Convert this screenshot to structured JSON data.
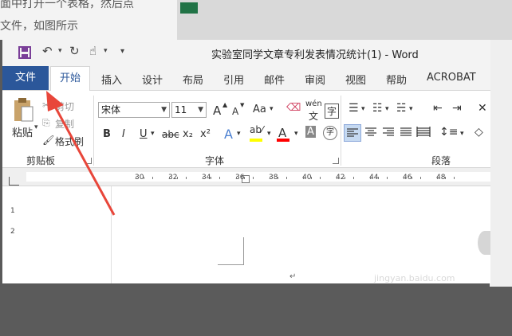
{
  "background": {
    "tutorial_text_line1": "面中打开一个表格，然后点",
    "tutorial_text_line2": "文件，如图所示"
  },
  "window": {
    "title": "实验室同学文章专利发表情况统计(1)  -  Word"
  },
  "quick_access": {
    "save_icon": "save-icon",
    "undo_icon": "undo-icon",
    "redo_icon": "redo-icon",
    "touch_icon": "touch-mode-icon",
    "customize_icon": "customize-icon"
  },
  "tabs": {
    "file": "文件",
    "home": "开始",
    "items": [
      "插入",
      "设计",
      "布局",
      "引用",
      "邮件",
      "审阅",
      "视图",
      "帮助",
      "ACROBAT"
    ]
  },
  "clipboard": {
    "paste_label": "粘贴",
    "cut_label": "剪切",
    "copy_label": "复制",
    "format_painter_label": "格式刷",
    "group_label": "剪贴板"
  },
  "font": {
    "font_name": "宋体",
    "font_size": "11",
    "grow_label": "A",
    "shrink_label": "A",
    "case_label": "Aa",
    "pinyin_label": "wén",
    "bold_label": "B",
    "italic_label": "I",
    "underline_label": "U",
    "strike_label": "abc",
    "sub_label": "x₂",
    "sup_label": "x²",
    "group_label": "字体",
    "char_border_label": "字",
    "highlight_color": "#ffff00",
    "font_color": "#ff0000"
  },
  "paragraph": {
    "group_label": "段落"
  },
  "ruler": {
    "numbers": [
      "30",
      "32",
      "34",
      "36",
      "38",
      "40",
      "42",
      "44",
      "46",
      "48"
    ]
  },
  "vertical_ruler": {
    "numbers": [
      "1",
      "2"
    ]
  },
  "document": {
    "paragraph_mark": "↵"
  },
  "watermark": {
    "text": "jingyan.baidu.com"
  },
  "colors": {
    "accent": "#2b579a",
    "arrow": "#e8463a"
  }
}
